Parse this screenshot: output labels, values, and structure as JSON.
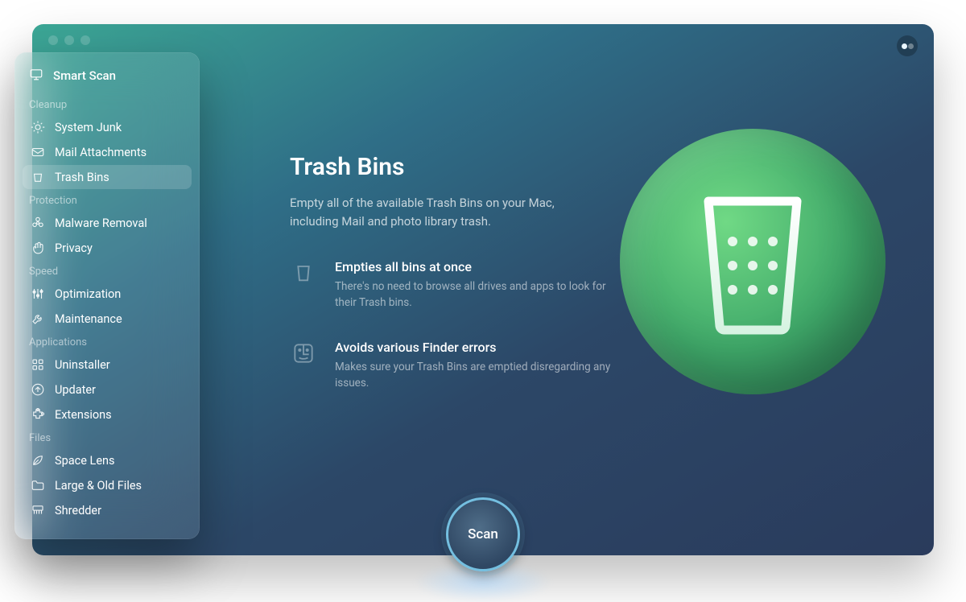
{
  "sidebar": {
    "smart_scan": "Smart Scan",
    "sections": {
      "cleanup": {
        "label": "Cleanup",
        "items": [
          "System Junk",
          "Mail Attachments",
          "Trash Bins"
        ]
      },
      "protection": {
        "label": "Protection",
        "items": [
          "Malware Removal",
          "Privacy"
        ]
      },
      "speed": {
        "label": "Speed",
        "items": [
          "Optimization",
          "Maintenance"
        ]
      },
      "applications": {
        "label": "Applications",
        "items": [
          "Uninstaller",
          "Updater",
          "Extensions"
        ]
      },
      "files": {
        "label": "Files",
        "items": [
          "Space Lens",
          "Large & Old Files",
          "Shredder"
        ]
      }
    },
    "active_item": "Trash Bins"
  },
  "main": {
    "title": "Trash Bins",
    "subtitle": "Empty all of the available Trash Bins on your Mac, including Mail and photo library trash.",
    "features": [
      {
        "title": "Empties all bins at once",
        "desc": "There's no need to browse all drives and apps to look for their Trash bins."
      },
      {
        "title": "Avoids various Finder errors",
        "desc": "Makes sure your Trash Bins are emptied disregarding any issues."
      }
    ],
    "scan_label": "Scan"
  },
  "icons": {
    "smart_scan": "monitor-icon",
    "system_junk": "gear-spark-icon",
    "mail_attachments": "envelope-icon",
    "trash_bins": "trash-icon",
    "malware_removal": "biohazard-icon",
    "privacy": "hand-icon",
    "optimization": "sliders-icon",
    "maintenance": "wrench-icon",
    "uninstaller": "blocks-icon",
    "updater": "arrow-up-circle-icon",
    "extensions": "puzzle-icon",
    "space_lens": "leaf-icon",
    "large_old_files": "folder-icon",
    "shredder": "shredder-icon"
  },
  "colors": {
    "accent_green": "#5cc97a",
    "scan_ring": "#74bfe0"
  }
}
